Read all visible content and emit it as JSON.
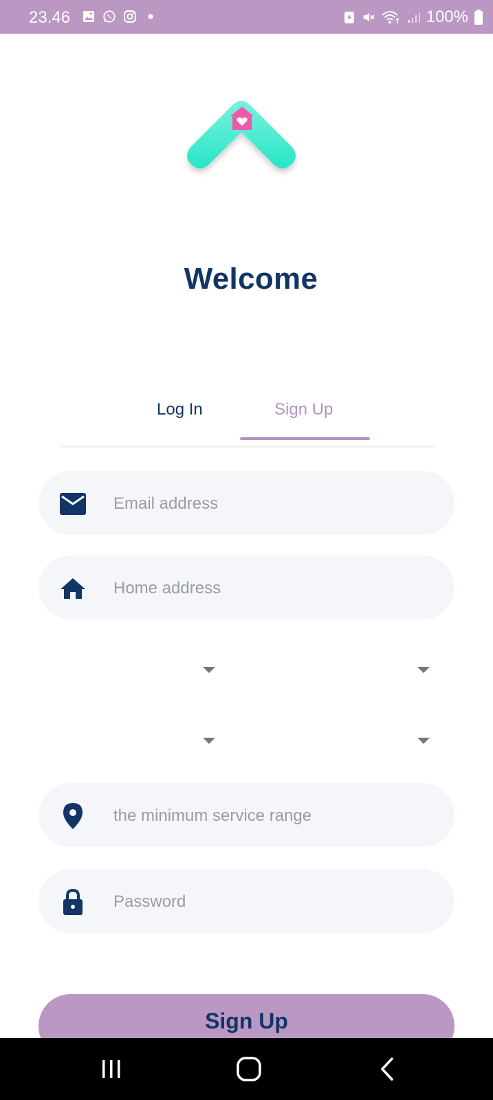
{
  "status_bar": {
    "time": "23.46",
    "battery": "100%",
    "left_icons": [
      "gallery-icon",
      "whatsapp-icon",
      "instagram-icon",
      "dot-icon"
    ],
    "right_icons": [
      "battery-saver-icon",
      "mute-icon",
      "wifi-icon",
      "signal-icon",
      "battery-icon"
    ]
  },
  "welcome": {
    "title": "Welcome"
  },
  "tabs": [
    {
      "label": "Log In",
      "active": false
    },
    {
      "label": "Sign Up",
      "active": true
    }
  ],
  "form": {
    "email": {
      "placeholder": "Email address",
      "value": "",
      "icon": "mail-icon"
    },
    "home": {
      "placeholder": "Home address",
      "value": "",
      "icon": "home-icon"
    },
    "range": {
      "placeholder": "the minimum service range",
      "value": "",
      "icon": "location-pin-icon"
    },
    "password": {
      "placeholder": "Password",
      "value": "",
      "icon": "lock-icon"
    }
  },
  "submit": {
    "label": "Sign Up"
  },
  "colors": {
    "accent": "#bb97c4",
    "primary": "#133565",
    "field_bg": "#f4f6fa",
    "logo_teal": "#2fe8c8",
    "logo_pink": "#ee5aa8"
  },
  "nav_bar": {
    "buttons": [
      "recent-apps-icon",
      "home-button-icon",
      "back-icon"
    ]
  }
}
